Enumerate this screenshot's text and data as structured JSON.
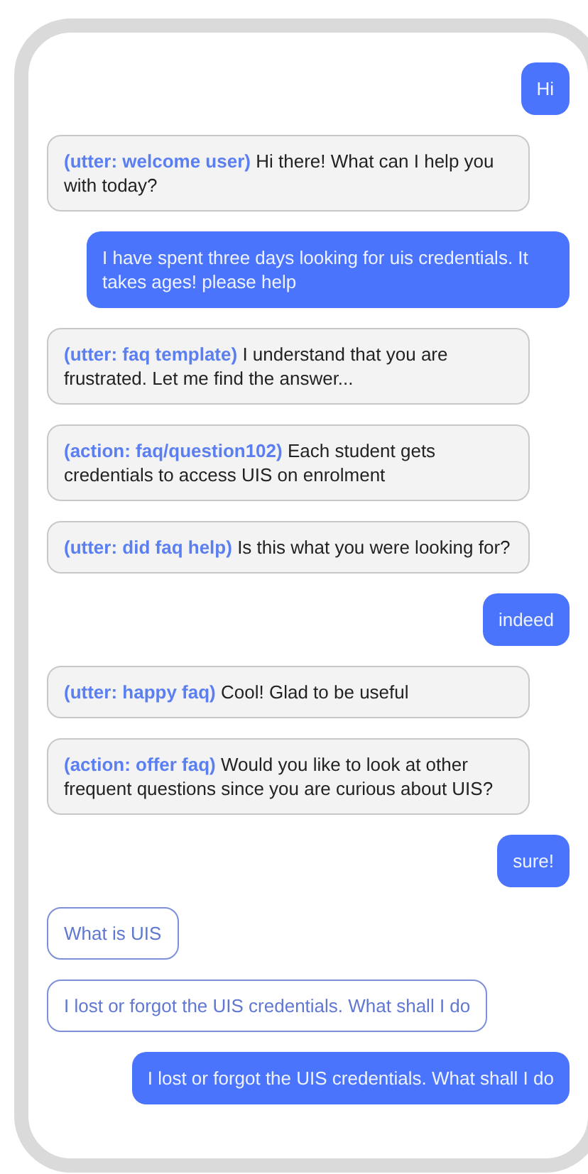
{
  "messages": [
    {
      "kind": "user",
      "text": "Hi"
    },
    {
      "kind": "bot",
      "tag": "(utter: welcome user)",
      "text": "Hi there! What can I help you with today?"
    },
    {
      "kind": "user",
      "text": "I have spent three days looking for uis credentials. It takes ages! please help"
    },
    {
      "kind": "bot",
      "tag": "(utter: faq template)",
      "text": "I understand that you are frustrated. Let me find the answer..."
    },
    {
      "kind": "bot",
      "tag": "(action: faq/question102)",
      "text": "Each student gets credentials to access UIS on enrolment"
    },
    {
      "kind": "bot",
      "tag": "(utter: did faq help)",
      "text": "Is this what you were looking for?"
    },
    {
      "kind": "user",
      "text": "indeed"
    },
    {
      "kind": "bot",
      "tag": "(utter: happy faq)",
      "text": "Cool! Glad to be useful"
    },
    {
      "kind": "bot",
      "tag": "(action: offer faq)",
      "text": "Would you like to look at other frequent questions since you are curious about UIS?"
    },
    {
      "kind": "user",
      "text": "sure!"
    },
    {
      "kind": "quick_reply",
      "text": "What is UIS"
    },
    {
      "kind": "quick_reply",
      "text": "I lost or forgot the UIS credentials. What shall I do"
    },
    {
      "kind": "user",
      "text": "I lost or forgot the UIS credentials. What shall I do"
    }
  ]
}
